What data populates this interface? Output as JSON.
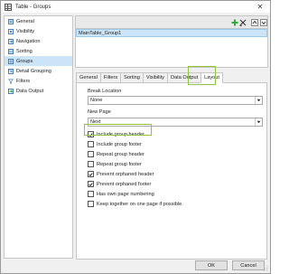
{
  "window": {
    "title": "Table - Groups",
    "close_glyph": "✕"
  },
  "nav": {
    "items": [
      {
        "label": "General",
        "icon": "general-icon",
        "selected": false
      },
      {
        "label": "Visibility",
        "icon": "visibility-icon",
        "selected": false
      },
      {
        "label": "Navigation",
        "icon": "navigation-icon",
        "selected": false
      },
      {
        "label": "Sorting",
        "icon": "sorting-icon",
        "selected": false
      },
      {
        "label": "Groups",
        "icon": "groups-icon",
        "selected": true
      },
      {
        "label": "Detail Grouping",
        "icon": "detail-grouping-icon",
        "selected": false
      },
      {
        "label": "Filters",
        "icon": "filters-icon",
        "selected": false
      },
      {
        "label": "Data Output",
        "icon": "data-output-icon",
        "selected": false
      }
    ]
  },
  "groups_list": {
    "items": [
      "MainTable_Group1"
    ]
  },
  "tabs": [
    "General",
    "Filters",
    "Sorting",
    "Visibility",
    "Data Output",
    "Layout"
  ],
  "active_tab": "Layout",
  "layout": {
    "break_location": {
      "label": "Break Location",
      "value": "None"
    },
    "new_page": {
      "label": "New Page",
      "value": "Next"
    },
    "checkboxes": [
      {
        "label": "Include group header",
        "checked": true
      },
      {
        "label": "Include group footer",
        "checked": false
      },
      {
        "label": "Repeat group header",
        "checked": false
      },
      {
        "label": "Repeat group footer",
        "checked": false
      },
      {
        "label": "Prevent orphaned header",
        "checked": true
      },
      {
        "label": "Prevent orphaned footer",
        "checked": true
      },
      {
        "label": "Has own page numbering",
        "checked": false
      },
      {
        "label": "Keep together on one page if possible.",
        "checked": false
      }
    ]
  },
  "buttons": {
    "ok": "OK",
    "cancel": "Cancel"
  },
  "colors": {
    "accent_highlight": "#8ec63f",
    "selection": "#cce4f7",
    "add_icon": "#2eaa3e"
  }
}
